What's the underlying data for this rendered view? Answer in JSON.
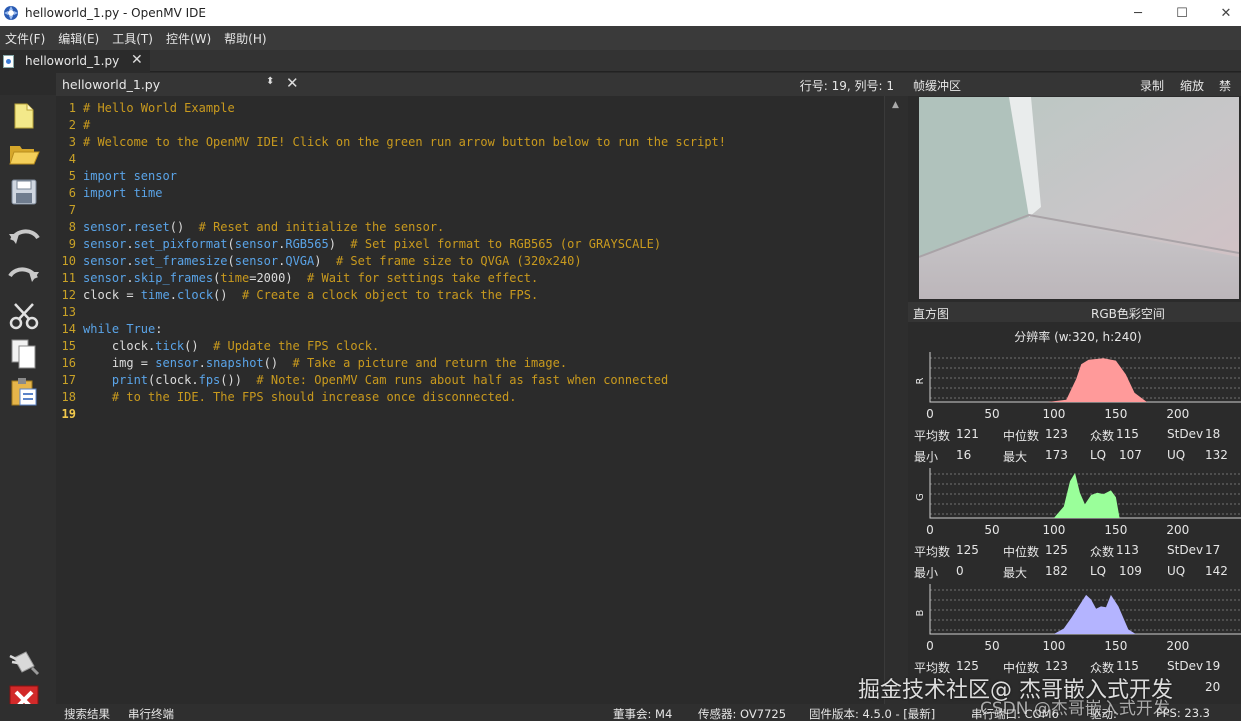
{
  "window": {
    "title": "helloworld_1.py - OpenMV IDE",
    "controls": [
      "─",
      "☐",
      "✕"
    ]
  },
  "menu": [
    "文件(F)",
    "编辑(E)",
    "工具(T)",
    "控件(W)",
    "帮助(H)"
  ],
  "file_tab": {
    "label": "helloworld_1.py",
    "close": "✕"
  },
  "editor_header": {
    "filename": "helloworld_1.py",
    "switcher": "⬍",
    "close": "✕",
    "cursor_pos": "行号: 19, 列号: 1"
  },
  "code_lines": [
    {
      "n": "1",
      "parts": [
        {
          "c": "cm",
          "t": "# Hello World Example"
        }
      ]
    },
    {
      "n": "2",
      "parts": [
        {
          "c": "cm",
          "t": "#"
        }
      ]
    },
    {
      "n": "3",
      "parts": [
        {
          "c": "cm",
          "t": "# Welcome to the OpenMV IDE! Click on the green run arrow button below to run the script!"
        }
      ]
    },
    {
      "n": "4",
      "parts": []
    },
    {
      "n": "5",
      "parts": [
        {
          "c": "kw",
          "t": "import sensor"
        }
      ]
    },
    {
      "n": "6",
      "parts": [
        {
          "c": "kw",
          "t": "import time"
        }
      ]
    },
    {
      "n": "7",
      "parts": []
    },
    {
      "n": "8",
      "parts": [
        {
          "c": "kw",
          "t": "sensor"
        },
        {
          "c": "",
          "t": "."
        },
        {
          "c": "kw",
          "t": "reset"
        },
        {
          "c": "",
          "t": "()  "
        },
        {
          "c": "cm",
          "t": "# Reset and initialize the sensor."
        }
      ]
    },
    {
      "n": "9",
      "parts": [
        {
          "c": "kw",
          "t": "sensor"
        },
        {
          "c": "",
          "t": "."
        },
        {
          "c": "kw",
          "t": "set_pixformat"
        },
        {
          "c": "",
          "t": "("
        },
        {
          "c": "kw",
          "t": "sensor"
        },
        {
          "c": "",
          "t": "."
        },
        {
          "c": "kw",
          "t": "RGB565"
        },
        {
          "c": "",
          "t": ")  "
        },
        {
          "c": "cm",
          "t": "# Set pixel format to RGB565 (or GRAYSCALE)"
        }
      ]
    },
    {
      "n": "10",
      "parts": [
        {
          "c": "kw",
          "t": "sensor"
        },
        {
          "c": "",
          "t": "."
        },
        {
          "c": "kw",
          "t": "set_framesize"
        },
        {
          "c": "",
          "t": "("
        },
        {
          "c": "kw",
          "t": "sensor"
        },
        {
          "c": "",
          "t": "."
        },
        {
          "c": "kw",
          "t": "QVGA"
        },
        {
          "c": "",
          "t": ")  "
        },
        {
          "c": "cm",
          "t": "# Set frame size to QVGA (320x240)"
        }
      ]
    },
    {
      "n": "11",
      "parts": [
        {
          "c": "kw",
          "t": "sensor"
        },
        {
          "c": "",
          "t": "."
        },
        {
          "c": "kw",
          "t": "skip_frames"
        },
        {
          "c": "",
          "t": "("
        },
        {
          "c": "cm",
          "t": "time"
        },
        {
          "c": "",
          "t": "=2000)  "
        },
        {
          "c": "cm",
          "t": "# Wait for settings take effect."
        }
      ]
    },
    {
      "n": "12",
      "parts": [
        {
          "c": "",
          "t": "clock = "
        },
        {
          "c": "kw",
          "t": "time"
        },
        {
          "c": "",
          "t": "."
        },
        {
          "c": "kw",
          "t": "clock"
        },
        {
          "c": "",
          "t": "()  "
        },
        {
          "c": "cm",
          "t": "# Create a clock object to track the FPS."
        }
      ]
    },
    {
      "n": "13",
      "parts": []
    },
    {
      "n": "14",
      "parts": [
        {
          "c": "kw",
          "t": "while True"
        },
        {
          "c": "",
          "t": ":"
        }
      ]
    },
    {
      "n": "15",
      "parts": [
        {
          "c": "",
          "t": "    clock."
        },
        {
          "c": "kw",
          "t": "tick"
        },
        {
          "c": "",
          "t": "()  "
        },
        {
          "c": "cm",
          "t": "# Update the FPS clock."
        }
      ]
    },
    {
      "n": "16",
      "parts": [
        {
          "c": "",
          "t": "    img = "
        },
        {
          "c": "kw",
          "t": "sensor"
        },
        {
          "c": "",
          "t": "."
        },
        {
          "c": "kw",
          "t": "snapshot"
        },
        {
          "c": "",
          "t": "()  "
        },
        {
          "c": "cm",
          "t": "# Take a picture and return the image."
        }
      ]
    },
    {
      "n": "17",
      "parts": [
        {
          "c": "",
          "t": "    "
        },
        {
          "c": "kw",
          "t": "print"
        },
        {
          "c": "",
          "t": "(clock."
        },
        {
          "c": "kw",
          "t": "fps"
        },
        {
          "c": "",
          "t": "())  "
        },
        {
          "c": "cm",
          "t": "# Note: OpenMV Cam runs about half as fast when connected"
        }
      ]
    },
    {
      "n": "18",
      "parts": [
        {
          "c": "",
          "t": "    "
        },
        {
          "c": "cm",
          "t": "# to the IDE. The FPS should increase once disconnected."
        }
      ]
    },
    {
      "n": "19",
      "parts": []
    }
  ],
  "current_line": "19",
  "frame_buffer": {
    "title": "帧缓冲区",
    "record": "录制",
    "zoom": "缩放",
    "disable": "禁用"
  },
  "histogram": {
    "title": "直方图",
    "colorspace": "RGB色彩空间",
    "resolution": "分辨率 (w:320, h:240)",
    "x_ticks": [
      "0",
      "50",
      "100",
      "150",
      "200"
    ],
    "channels": [
      {
        "label": "R",
        "color": "#ff9a9a",
        "stats": {
          "mean_label": "平均数",
          "mean": "121",
          "median_label": "中位数",
          "median": "123",
          "mode_label": "众数",
          "mode": "115",
          "stdev_label": "StDev",
          "stdev": "18",
          "min_label": "最小",
          "min": "16",
          "max_label": "最大",
          "max": "173",
          "lq_label": "LQ",
          "lq": "107",
          "uq_label": "UQ",
          "uq": "132"
        }
      },
      {
        "label": "G",
        "color": "#9aff9a",
        "stats": {
          "mean_label": "平均数",
          "mean": "125",
          "median_label": "中位数",
          "median": "125",
          "mode_label": "众数",
          "mode": "113",
          "stdev_label": "StDev",
          "stdev": "17",
          "min_label": "最小",
          "min": "0",
          "max_label": "最大",
          "max": "182",
          "lq_label": "LQ",
          "lq": "109",
          "uq_label": "UQ",
          "uq": "142"
        }
      },
      {
        "label": "B",
        "color": "#b4b4ff",
        "stats": {
          "mean_label": "平均数",
          "mean": "125",
          "median_label": "中位数",
          "median": "123",
          "mode_label": "众数",
          "mode": "115",
          "stdev_label": "StDev",
          "stdev": "19",
          "min_label": "",
          "min": "",
          "max_label": "",
          "max": "",
          "lq_label": "",
          "lq": "",
          "uq_label": "",
          "uq": "20"
        }
      }
    ]
  },
  "status": {
    "search_results": "搜索结果",
    "serial_terminal": "串行终端",
    "board": "董事会: M4",
    "sensor": "传感器: OV7725",
    "firmware": "固件版本: 4.5.0 - [最新]",
    "serial_port": "串行端口: COM6",
    "driver": "驱动:",
    "fps": "FPS: 23.3"
  },
  "watermark": "掘金技术社区@ 杰哥嵌入式开发",
  "watermark2": "CSDN @杰哥嵌入式开发"
}
